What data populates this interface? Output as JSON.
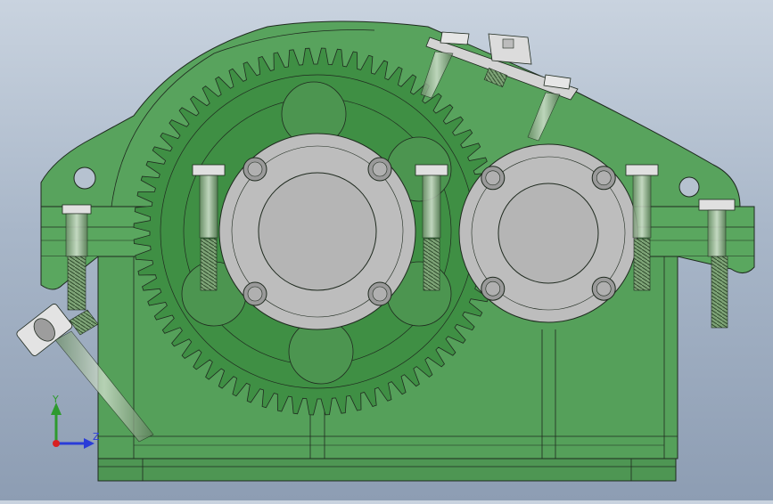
{
  "view": {
    "background_top": "#c9d3df",
    "background_bottom": "#8d9db3",
    "housing_color": "#4f9a55",
    "housing_dark": "#3d7f43",
    "gear_color": "#3f8f44",
    "bearing_color": "#b9b9b9",
    "steel_color": "#d8d8d8",
    "outline_color": "#1f2a1f"
  },
  "triad": {
    "y_label": "Y",
    "z_label": "Z",
    "y_color": "#2e9a2e",
    "z_color": "#2a3cd8",
    "x_color": "#d82020"
  },
  "model": {
    "gear_teeth": 72,
    "large_bearing_bolts": 4,
    "small_bearing_bolts": 4
  }
}
